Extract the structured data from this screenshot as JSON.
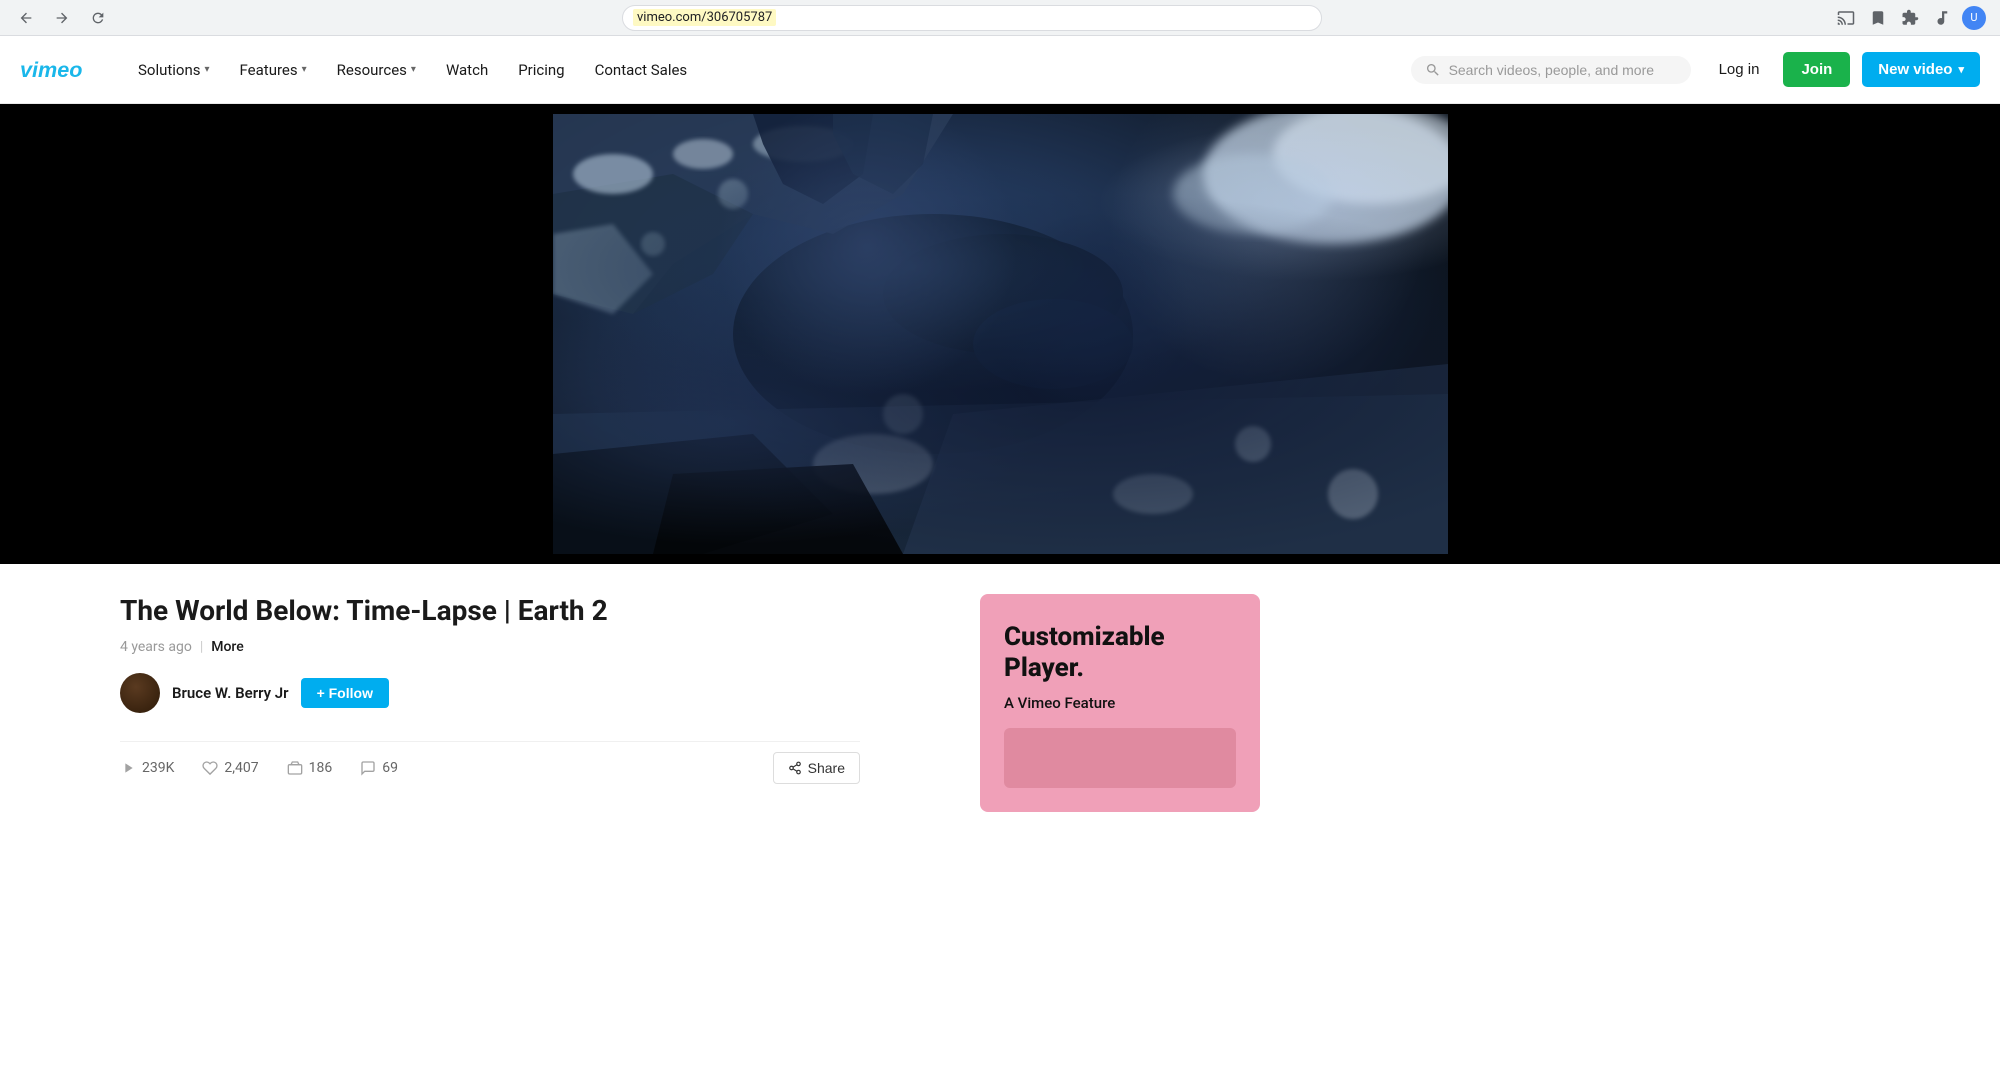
{
  "browser": {
    "url": "vimeo.com/306705787",
    "back_disabled": false,
    "forward_disabled": false
  },
  "header": {
    "logo_alt": "Vimeo",
    "nav": {
      "solutions_label": "Solutions",
      "features_label": "Features",
      "resources_label": "Resources",
      "watch_label": "Watch",
      "pricing_label": "Pricing",
      "contact_sales_label": "Contact Sales"
    },
    "search_placeholder": "Search videos, people, and more",
    "login_label": "Log in",
    "join_label": "Join",
    "new_video_label": "New video"
  },
  "video": {
    "title": "The World Below: Time-Lapse | Earth 2",
    "age": "4 years ago",
    "more_label": "More",
    "author_name": "Bruce W. Berry Jr",
    "follow_label": "+ Follow",
    "stats": {
      "views": "239K",
      "likes": "2,407",
      "collections": "186",
      "comments": "69"
    },
    "share_label": "Share"
  },
  "ad": {
    "title": "Customizable\nPlayer.",
    "subtitle": "A Vimeo Feature"
  }
}
